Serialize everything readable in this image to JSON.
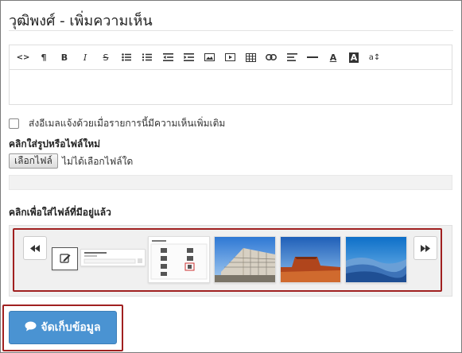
{
  "page": {
    "title": "วุฒิพงศ์ - เพิ่มความเห็น"
  },
  "toolbar": {
    "buttons": [
      {
        "name": "code-view",
        "glyph": "<>"
      },
      {
        "name": "paragraph",
        "glyph": "¶"
      },
      {
        "name": "bold",
        "glyph": "B"
      },
      {
        "name": "italic",
        "glyph": "I"
      },
      {
        "name": "strikethrough",
        "glyph": "S"
      },
      {
        "name": "unordered-list",
        "glyph": ""
      },
      {
        "name": "ordered-list",
        "glyph": ""
      },
      {
        "name": "outdent",
        "glyph": ""
      },
      {
        "name": "indent",
        "glyph": ""
      },
      {
        "name": "insert-image",
        "glyph": ""
      },
      {
        "name": "insert-video",
        "glyph": ""
      },
      {
        "name": "insert-table",
        "glyph": ""
      },
      {
        "name": "insert-link",
        "glyph": ""
      },
      {
        "name": "align",
        "glyph": ""
      },
      {
        "name": "horizontal-rule",
        "glyph": ""
      },
      {
        "name": "font-color",
        "glyph": "A"
      },
      {
        "name": "background-color",
        "glyph": "A"
      },
      {
        "name": "font-size",
        "glyph": "a↕"
      }
    ]
  },
  "notify": {
    "label": "ส่งอีเมลแจ้งด้วยเมื่อรายการนี้มีความเห็นเพิ่มเติม",
    "checked": false
  },
  "upload": {
    "heading": "คลิกใส่รูปหรือไฟล์ใหม่",
    "button_label": "เลือกไฟล์",
    "no_file_text": "ไม่ได้เลือกไฟล์ใด"
  },
  "gallery": {
    "heading": "คลิกเพื่อใส่ไฟล์ที่มีอยู่แล้ว"
  },
  "save": {
    "label": "จัดเก็บข้อมูล"
  }
}
